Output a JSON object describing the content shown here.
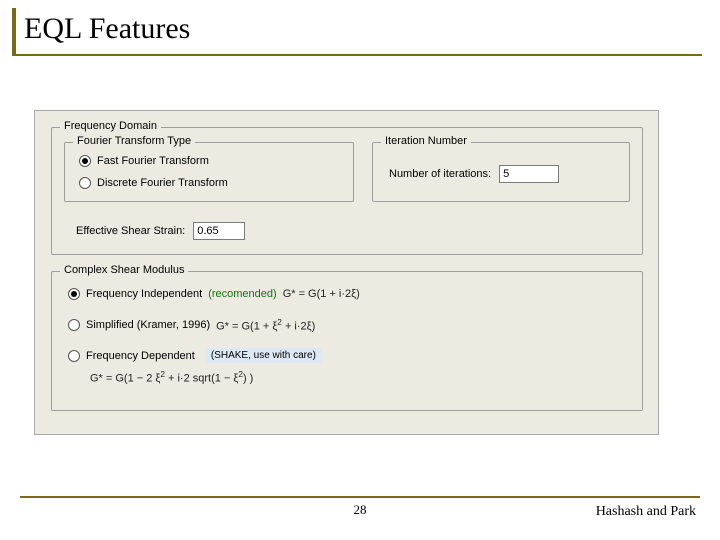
{
  "title": "EQL Features",
  "panel": {
    "freq_domain": {
      "label": "Frequency Domain",
      "fourier_type": {
        "label": "Fourier Transform Type",
        "options": {
          "fft": "Fast Fourier Transform",
          "dft": "Discrete Fourier Transform"
        },
        "selected": "fft"
      },
      "iteration": {
        "label": "Iteration Number",
        "field_label": "Number of iterations:",
        "value": "5"
      },
      "ess": {
        "label": "Effective Shear Strain:",
        "value": "0.65"
      }
    },
    "csm": {
      "label": "Complex Shear Modulus",
      "options": {
        "fi": {
          "label": "Frequency Independent",
          "note": "(recomended)",
          "formula": "G* = G(1 + i·2ξ)"
        },
        "simp": {
          "label": "Simplified (Kramer, 1996)",
          "formula_pre": "G* = G(1 + ",
          "formula_mid": "ξ",
          "formula_post": " + i·2ξ)"
        },
        "fd": {
          "label": "Frequency Dependent",
          "note": "(SHAKE, use with care)",
          "formula_pre": "G* = G(1 − 2 ξ",
          "formula_mid": " + i·2 sqrt(1 − ξ",
          "formula_post": ") )"
        }
      },
      "selected": "fi"
    }
  },
  "footer": {
    "page": "28",
    "authors": "Hashash and Park"
  }
}
